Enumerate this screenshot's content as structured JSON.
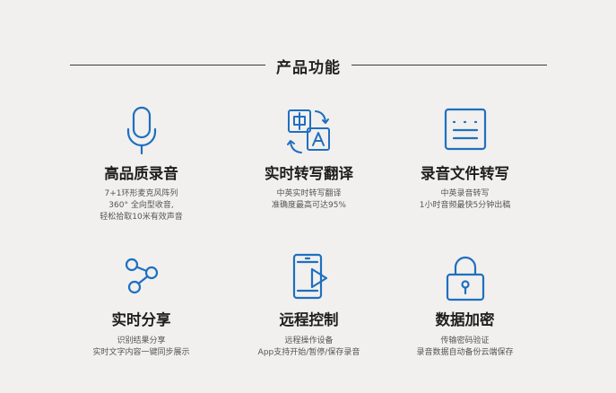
{
  "header": {
    "title": "产品功能"
  },
  "colors": {
    "accent": "#1f6fc0",
    "text": "#1e1e1e",
    "muted": "#555555",
    "background": "#f1f0ee"
  },
  "features": [
    {
      "icon": "microphone-icon",
      "title": "高品质录音",
      "desc": [
        "7+1环形麦克风阵列",
        "360° 全向型收音,",
        "轻松拾取10米有效声音"
      ]
    },
    {
      "icon": "translate-icon",
      "title": "实时转写翻译",
      "desc": [
        "中英实时转写翻译",
        "准确度最高可达95%"
      ]
    },
    {
      "icon": "document-icon",
      "title": "录音文件转写",
      "desc": [
        "中英录音转写",
        "1小时音频最快5分钟出稿"
      ]
    },
    {
      "icon": "share-icon",
      "title": "实时分享",
      "desc": [
        "识别结果分享",
        "实时文字内容一键同步展示"
      ]
    },
    {
      "icon": "remote-control-icon",
      "title": "远程控制",
      "desc": [
        "远程操作设备",
        "App支持开始/暂停/保存录音"
      ]
    },
    {
      "icon": "lock-icon",
      "title": "数据加密",
      "desc": [
        "传输密码验证",
        "录音数据自动备份云端保存"
      ]
    }
  ]
}
